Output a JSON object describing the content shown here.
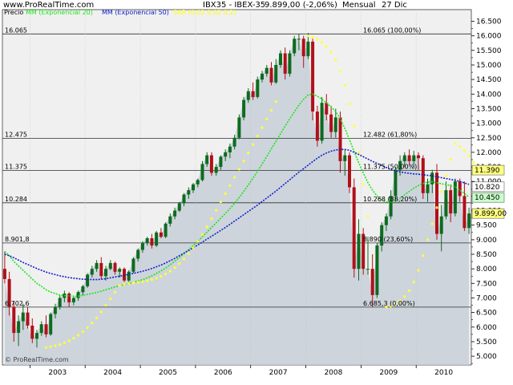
{
  "header": {
    "site": "www.ProRealTime.com",
    "symbol": "IBX35 - IBEX-35",
    "last": "9.899,00 (-2,06%)",
    "period": "Mensual",
    "date": "27 Dic"
  },
  "legend": {
    "price": "Precio",
    "ma20": "MM (Exponencial 20)",
    "ma50": "MM (Exponencial 50)",
    "sar": "SAR (0,02 0,02 0,2)"
  },
  "watermark": "© ProRealTime.com",
  "colors": {
    "up": "#0d6b1f",
    "down": "#b0101a",
    "ma20": "#19e619",
    "ma50": "#1020c8",
    "sar": "#ffff3c",
    "area": "#c8cfd8",
    "background": "#f0f0f0"
  },
  "levels": [
    {
      "left": "16.065",
      "right": "16.065 (100,00%)",
      "value": 16065
    },
    {
      "left": "12.475",
      "right": "12.482 (61,80%)",
      "value": 12482
    },
    {
      "left": "11.375",
      "right": "11.375 (50,00%)",
      "value": 11375
    },
    {
      "left": "10.284",
      "right": "10.268 (38,20%)",
      "value": 10268
    },
    {
      "left": "8.901,8",
      "right": "8.890 (23,60%)",
      "value": 8890
    },
    {
      "left": "6.702,6",
      "right": "6.685,3 (0,00%)",
      "value": 6685
    }
  ],
  "badges": [
    {
      "text": "11.390",
      "value": 11390,
      "color": "#ffff80"
    },
    {
      "text": "10.820",
      "value": 10820,
      "color": "#ffffff"
    },
    {
      "text": "10.450",
      "value": 10450,
      "color": "#c8ffc8"
    },
    {
      "text": "9.899,00",
      "value": 9899,
      "color": "#ffff80"
    }
  ],
  "chart_data": {
    "type": "candlestick",
    "x_start": "2002-07",
    "x_period": "month",
    "xticks": [
      "2003",
      "2004",
      "2005",
      "2006",
      "2007",
      "2008",
      "2009",
      "2010"
    ],
    "yticks": [
      "5.000",
      "5.500",
      "6.000",
      "6.500",
      "7.000",
      "7.500",
      "8.000",
      "8.500",
      "9.000",
      "9.500",
      "10.000",
      "10.500",
      "11.000",
      "11.500",
      "12.000",
      "12.500",
      "13.000",
      "13.500",
      "14.000",
      "14.500",
      "15.000",
      "15.500",
      "16.000",
      "16.500"
    ],
    "ylim": [
      4700,
      16900
    ],
    "ohlc": [
      [
        8000,
        8600,
        7500,
        7650
      ],
      [
        7650,
        7900,
        6400,
        6700
      ],
      [
        6700,
        6900,
        5500,
        5800
      ],
      [
        5800,
        6400,
        5350,
        6200
      ],
      [
        6200,
        6800,
        5900,
        6500
      ],
      [
        6500,
        6700,
        5950,
        6050
      ],
      [
        6050,
        6300,
        5450,
        5600
      ],
      [
        5600,
        5900,
        5300,
        5800
      ],
      [
        5800,
        6200,
        5700,
        6100
      ],
      [
        6100,
        6400,
        5650,
        5750
      ],
      [
        5750,
        6500,
        5700,
        6450
      ],
      [
        6450,
        6800,
        6300,
        6700
      ],
      [
        6700,
        7100,
        6600,
        7000
      ],
      [
        7000,
        7250,
        6850,
        7150
      ],
      [
        7150,
        7200,
        6700,
        6850
      ],
      [
        6850,
        7050,
        6750,
        7000
      ],
      [
        7000,
        7250,
        6900,
        7200
      ],
      [
        7200,
        7450,
        7100,
        7400
      ],
      [
        7400,
        7850,
        7350,
        7800
      ],
      [
        7800,
        8100,
        7700,
        8000
      ],
      [
        8000,
        8300,
        7900,
        8200
      ],
      [
        8200,
        8400,
        7650,
        7750
      ],
      [
        7750,
        8100,
        7600,
        8000
      ],
      [
        8000,
        8300,
        7950,
        8200
      ],
      [
        8200,
        8250,
        7800,
        7900
      ],
      [
        7900,
        8050,
        7700,
        8000
      ],
      [
        8000,
        8050,
        7550,
        7600
      ],
      [
        7600,
        7950,
        7550,
        7900
      ],
      [
        7900,
        8400,
        7850,
        8350
      ],
      [
        8350,
        8700,
        8250,
        8650
      ],
      [
        8650,
        8950,
        8550,
        8900
      ],
      [
        8900,
        9100,
        8800,
        9050
      ],
      [
        9050,
        9200,
        8700,
        8800
      ],
      [
        8800,
        9300,
        8750,
        9250
      ],
      [
        9250,
        9400,
        9050,
        9100
      ],
      [
        9100,
        9600,
        9050,
        9550
      ],
      [
        9550,
        9900,
        9450,
        9800
      ],
      [
        9800,
        10100,
        9700,
        10000
      ],
      [
        10000,
        10300,
        9950,
        10250
      ],
      [
        10250,
        10600,
        10150,
        10550
      ],
      [
        10550,
        10800,
        10400,
        10700
      ],
      [
        10700,
        10950,
        10600,
        10900
      ],
      [
        10900,
        11100,
        10800,
        11050
      ],
      [
        11050,
        11700,
        11000,
        11600
      ],
      [
        11600,
        12000,
        11500,
        11900
      ],
      [
        11900,
        12000,
        11200,
        11300
      ],
      [
        11300,
        11600,
        11200,
        11500
      ],
      [
        11500,
        11900,
        11400,
        11850
      ],
      [
        11850,
        12100,
        11700,
        12000
      ],
      [
        12000,
        12300,
        11800,
        12200
      ],
      [
        12200,
        12600,
        12100,
        12500
      ],
      [
        12500,
        13300,
        12450,
        13200
      ],
      [
        13200,
        13900,
        13100,
        13800
      ],
      [
        13800,
        14200,
        13700,
        14100
      ],
      [
        14100,
        14400,
        13800,
        13900
      ],
      [
        13900,
        14600,
        13850,
        14500
      ],
      [
        14500,
        14800,
        14400,
        14700
      ],
      [
        14700,
        15000,
        14600,
        14900
      ],
      [
        14900,
        15100,
        14300,
        14400
      ],
      [
        14400,
        15200,
        14350,
        15000
      ],
      [
        15000,
        15500,
        14900,
        15400
      ],
      [
        15400,
        15600,
        14500,
        14700
      ],
      [
        14700,
        15500,
        14600,
        15400
      ],
      [
        15400,
        16000,
        15300,
        15900
      ],
      [
        15900,
        16065,
        15500,
        15900
      ],
      [
        15900,
        16000,
        14900,
        15300
      ],
      [
        15300,
        16100,
        15200,
        15800
      ],
      [
        15800,
        15900,
        13100,
        13400
      ],
      [
        13400,
        13600,
        12200,
        12400
      ],
      [
        12400,
        13900,
        12300,
        13700
      ],
      [
        13700,
        14000,
        13100,
        13300
      ],
      [
        13300,
        13600,
        12500,
        12700
      ],
      [
        12700,
        13500,
        12500,
        13200
      ],
      [
        13200,
        13400,
        11300,
        11700
      ],
      [
        11700,
        12100,
        11200,
        11900
      ],
      [
        11900,
        12000,
        10600,
        10800
      ],
      [
        10800,
        11100,
        7700,
        8000
      ],
      [
        8000,
        9700,
        7600,
        9200
      ],
      [
        9200,
        9400,
        7800,
        8000
      ],
      [
        8000,
        9100,
        7800,
        8000
      ],
      [
        8000,
        8500,
        6685,
        7100
      ],
      [
        7100,
        8900,
        7000,
        8800
      ],
      [
        8800,
        9600,
        8600,
        9500
      ],
      [
        9500,
        9900,
        9300,
        9800
      ],
      [
        9800,
        10700,
        9700,
        10500
      ],
      [
        10500,
        11500,
        10300,
        11400
      ],
      [
        11400,
        11900,
        11200,
        11700
      ],
      [
        11700,
        12000,
        11500,
        11900
      ],
      [
        11900,
        12100,
        11600,
        11700
      ],
      [
        11700,
        12050,
        11500,
        11900
      ],
      [
        11900,
        12000,
        11400,
        11800
      ],
      [
        11800,
        11900,
        10400,
        10600
      ],
      [
        10600,
        11100,
        10300,
        10900
      ],
      [
        10900,
        11400,
        10600,
        11300
      ],
      [
        11300,
        11600,
        9000,
        9200
      ],
      [
        9200,
        10200,
        8600,
        9800
      ],
      [
        9800,
        11000,
        9700,
        10700
      ],
      [
        10700,
        10900,
        9600,
        9900
      ],
      [
        9900,
        11100,
        9800,
        11000
      ],
      [
        11000,
        11100,
        10300,
        10500
      ],
      [
        10500,
        11000,
        9300,
        9400
      ],
      [
        9400,
        10100,
        9200,
        9899
      ]
    ],
    "ma20": [
      8600,
      8450,
      8250,
      8100,
      7950,
      7800,
      7650,
      7500,
      7400,
      7280,
      7200,
      7150,
      7100,
      7080,
      7070,
      7060,
      7060,
      7090,
      7120,
      7150,
      7190,
      7230,
      7280,
      7330,
      7380,
      7420,
      7460,
      7500,
      7540,
      7580,
      7630,
      7690,
      7760,
      7840,
      7930,
      8030,
      8140,
      8260,
      8390,
      8520,
      8660,
      8800,
      8950,
      9100,
      9260,
      9420,
      9580,
      9740,
      9900,
      10070,
      10250,
      10450,
      10660,
      10880,
      11110,
      11350,
      11600,
      11860,
      12120,
      12380,
      12640,
      12900,
      13150,
      13390,
      13620,
      13820,
      13970,
      14000,
      13930,
      13820,
      13700,
      13560,
      13400,
      13150,
      12820,
      12430,
      12030,
      11640,
      11290,
      10960,
      10700,
      10500,
      10370,
      10300,
      10290,
      10330,
      10420,
      10540,
      10660,
      10770,
      10860,
      10930,
      10980,
      10990,
      10960,
      10920,
      10890,
      10860,
      10820,
      10700,
      10590,
      10460
    ],
    "ma50": [
      8500,
      8450,
      8380,
      8300,
      8220,
      8150,
      8080,
      8010,
      7950,
      7890,
      7840,
      7800,
      7760,
      7730,
      7700,
      7680,
      7660,
      7645,
      7635,
      7630,
      7630,
      7640,
      7660,
      7690,
      7720,
      7750,
      7780,
      7810,
      7845,
      7880,
      7920,
      7960,
      8010,
      8070,
      8130,
      8200,
      8280,
      8360,
      8450,
      8540,
      8630,
      8720,
      8820,
      8920,
      9020,
      9120,
      9220,
      9320,
      9420,
      9530,
      9640,
      9750,
      9860,
      9970,
      10080,
      10190,
      10310,
      10430,
      10550,
      10670,
      10800,
      10930,
      11060,
      11190,
      11320,
      11440,
      11560,
      11680,
      11800,
      11900,
      11980,
      12040,
      12080,
      12100,
      12100,
      12070,
      12000,
      11930,
      11850,
      11770,
      11690,
      11620,
      11550,
      11480,
      11420,
      11370,
      11330,
      11300,
      11280,
      11260,
      11250,
      11230,
      11210,
      11190,
      11160,
      11130,
      11100,
      11070,
      11040,
      11000,
      10950,
      10900
    ],
    "sar": [
      null,
      null,
      null,
      null,
      null,
      null,
      null,
      null,
      null,
      5300,
      5330,
      5360,
      5400,
      5460,
      5530,
      5620,
      5720,
      5840,
      5980,
      6140,
      6320,
      6520,
      6740,
      6970,
      7200,
      7430,
      7470,
      7500,
      7520,
      7540,
      7560,
      7590,
      7630,
      7680,
      7740,
      7820,
      7920,
      8040,
      8180,
      8340,
      8520,
      8720,
      8940,
      9180,
      9440,
      9720,
      10010,
      10300,
      10580,
      10860,
      11140,
      11420,
      11700,
      11980,
      12270,
      12560,
      12850,
      13140,
      13440,
      13740,
      null,
      null,
      null,
      null,
      null,
      null,
      16000,
      15950,
      15880,
      15780,
      15640,
      15450,
      15180,
      14800,
      14300,
      13660,
      12900,
      12000,
      10900,
      9800,
      null,
      null,
      null,
      6685,
      6720,
      6800,
      6900,
      7050,
      7250,
      7550,
      7950,
      8450,
      9000,
      9550,
      10100,
      10650,
      11200,
      11750,
      12300,
      12200,
      12060,
      11880,
      11650,
      11390
    ]
  }
}
